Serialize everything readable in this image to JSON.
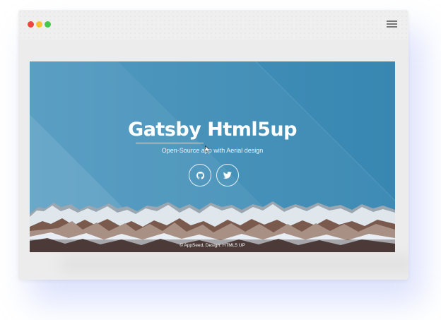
{
  "window": {
    "controls": [
      "close",
      "minimize",
      "maximize"
    ],
    "menu_icon": "hamburger-menu-icon"
  },
  "hero": {
    "title": "Gatsby Html5up",
    "subtitle": "Open-Source app with Aerial design",
    "social": [
      {
        "name": "github",
        "icon": "github-icon"
      },
      {
        "name": "twitter",
        "icon": "twitter-icon"
      }
    ]
  },
  "footer": {
    "text": "© AppSeed, Design: HTML5 UP"
  },
  "colors": {
    "background_blue": "#3a8ab4",
    "browser_chrome": "#ececec",
    "dot_red": "#f0443f",
    "dot_yellow": "#f7c233",
    "dot_green": "#45c94c"
  }
}
